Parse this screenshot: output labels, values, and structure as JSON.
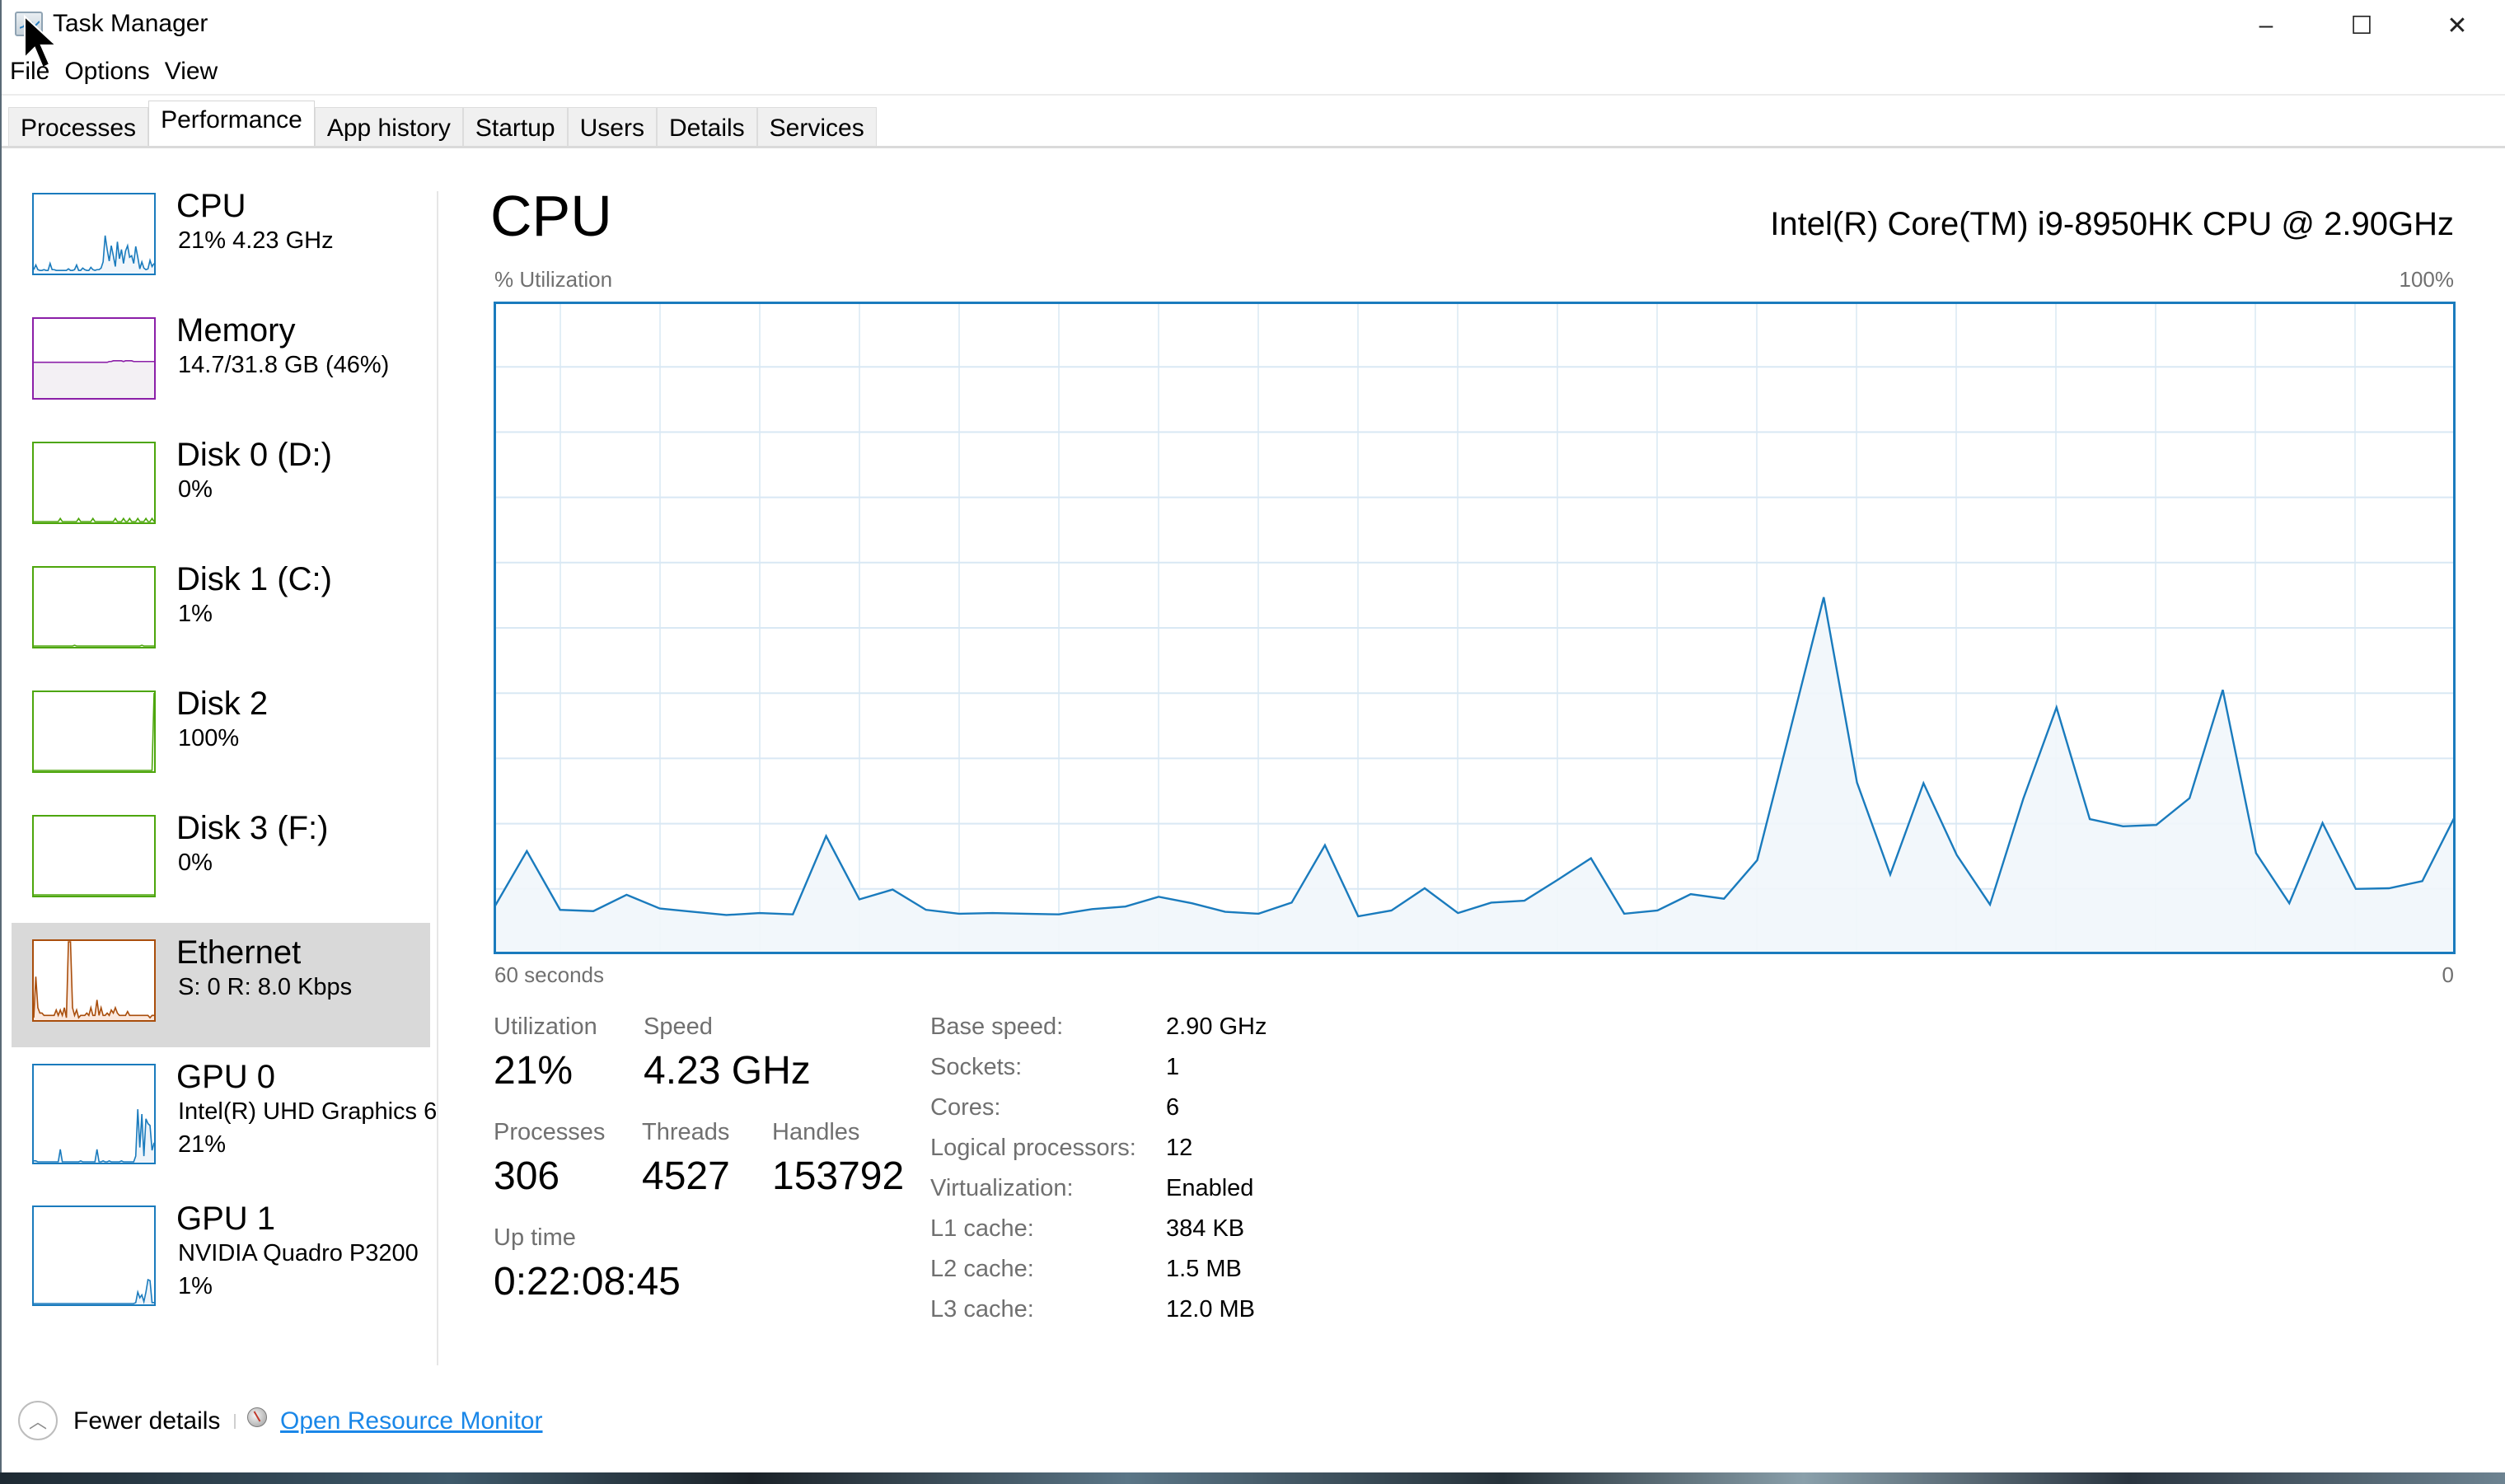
{
  "window": {
    "title": "Task Manager",
    "controls": {
      "minimize": "–",
      "maximize": "☐",
      "close": "✕"
    }
  },
  "menu": [
    "File",
    "Options",
    "View"
  ],
  "tabs": [
    {
      "label": "Processes",
      "active": false
    },
    {
      "label": "Performance",
      "active": true
    },
    {
      "label": "App history",
      "active": false
    },
    {
      "label": "Startup",
      "active": false
    },
    {
      "label": "Users",
      "active": false
    },
    {
      "label": "Details",
      "active": false
    },
    {
      "label": "Services",
      "active": false
    }
  ],
  "sidebar": {
    "items": [
      {
        "title": "CPU",
        "line1": "21%  4.23 GHz",
        "line2": "",
        "color": "#1a7bbd",
        "fill": "#f1f6fb",
        "selected": false,
        "trend": [
          4,
          10,
          4,
          3,
          3,
          4,
          3,
          3,
          12,
          4,
          4,
          3,
          3,
          3,
          3,
          3,
          3,
          5,
          3,
          3,
          4,
          10,
          3,
          3,
          6,
          4,
          3,
          3,
          7,
          4,
          3,
          4,
          4,
          6,
          14,
          48,
          30,
          15,
          35,
          22,
          8,
          40,
          18,
          30,
          12,
          28,
          35,
          20,
          22,
          12,
          34,
          20,
          5,
          14,
          6,
          4,
          5,
          16,
          8,
          12
        ]
      },
      {
        "title": "Memory",
        "line1": "14.7/31.8 GB (46%)",
        "line2": "",
        "color": "#8b1fa8",
        "fill": "#f3f0f4",
        "selected": false,
        "trend": [
          45,
          45,
          45,
          45,
          45,
          45,
          45,
          45,
          45,
          45,
          45,
          45,
          45,
          45,
          45,
          45,
          45,
          45,
          45,
          45,
          45,
          45,
          45,
          45,
          45,
          45,
          45,
          45,
          45,
          45,
          45,
          45,
          45,
          45,
          45,
          45,
          45,
          46,
          46,
          47,
          47,
          47,
          47,
          47,
          46,
          47,
          47,
          47,
          47,
          46,
          46,
          46,
          46,
          46,
          46,
          46,
          46,
          46,
          46,
          46
        ]
      },
      {
        "title": "Disk 0 (D:)",
        "line1": "0%",
        "line2": "",
        "color": "#4da60c",
        "fill": "#ffffff",
        "selected": false,
        "trend": [
          0,
          0,
          0,
          0,
          0,
          0,
          0,
          0,
          0,
          0,
          0,
          0,
          0,
          4,
          0,
          0,
          0,
          0,
          0,
          0,
          0,
          0,
          4,
          0,
          0,
          0,
          0,
          0,
          0,
          4,
          0,
          0,
          0,
          0,
          0,
          0,
          0,
          0,
          0,
          0,
          4,
          0,
          0,
          0,
          4,
          0,
          0,
          4,
          0,
          0,
          0,
          4,
          0,
          0,
          0,
          4,
          0,
          0,
          4,
          0
        ]
      },
      {
        "title": "Disk 1 (C:)",
        "line1": "1%",
        "line2": "",
        "color": "#4da60c",
        "fill": "#ffffff",
        "selected": false,
        "trend": [
          0,
          0,
          0,
          0,
          0,
          0,
          0,
          0,
          0,
          0,
          0,
          0,
          0,
          0,
          0,
          0,
          0,
          0,
          0,
          0,
          1,
          0,
          0,
          0,
          0,
          0,
          0,
          0,
          0,
          0,
          0,
          0,
          0,
          0,
          0,
          0,
          0,
          0,
          0,
          0,
          0,
          0,
          0,
          0,
          0,
          0,
          0,
          0,
          0,
          0,
          0,
          0,
          0,
          1,
          0,
          0,
          0,
          0,
          0,
          0
        ]
      },
      {
        "title": "Disk 2",
        "line1": "100%",
        "line2": "",
        "color": "#4da60c",
        "fill": "#ffffff",
        "selected": false,
        "trend": [
          0,
          0,
          0,
          0,
          0,
          0,
          0,
          0,
          0,
          0,
          0,
          0,
          0,
          0,
          0,
          0,
          0,
          0,
          0,
          0,
          0,
          0,
          0,
          0,
          0,
          0,
          0,
          0,
          0,
          0,
          0,
          0,
          0,
          0,
          0,
          0,
          0,
          0,
          0,
          0,
          0,
          0,
          0,
          0,
          0,
          0,
          0,
          0,
          0,
          0,
          0,
          0,
          0,
          0,
          0,
          0,
          0,
          0,
          0,
          100
        ]
      },
      {
        "title": "Disk 3 (F:)",
        "line1": "0%",
        "line2": "",
        "color": "#4da60c",
        "fill": "#ffffff",
        "selected": false,
        "trend": [
          0,
          0,
          0,
          0,
          0,
          0,
          0,
          0,
          0,
          0,
          0,
          0,
          0,
          0,
          0,
          0,
          0,
          0,
          0,
          0,
          0,
          0,
          0,
          0,
          0,
          0,
          0,
          0,
          0,
          0,
          0,
          0,
          0,
          0,
          0,
          0,
          0,
          0,
          0,
          0,
          0,
          0,
          0,
          0,
          0,
          0,
          0,
          0,
          0,
          0,
          0,
          0,
          0,
          0,
          0,
          0,
          0,
          0,
          0,
          0
        ]
      },
      {
        "title": "Ethernet",
        "line1": "S: 0  R: 8.0 Kbps",
        "line2": "",
        "color": "#a94e0c",
        "fill": "#fbe9df",
        "selected": true,
        "trend": [
          2,
          55,
          15,
          8,
          8,
          5,
          5,
          5,
          5,
          5,
          5,
          12,
          5,
          12,
          5,
          15,
          2,
          100,
          100,
          15,
          5,
          12,
          2,
          5,
          5,
          5,
          8,
          5,
          15,
          5,
          5,
          25,
          5,
          15,
          5,
          5,
          8,
          5,
          12,
          8,
          15,
          8,
          5,
          5,
          5,
          5,
          10,
          5,
          5,
          5,
          5,
          5,
          5,
          5,
          5,
          5,
          5,
          2,
          5,
          5
        ]
      },
      {
        "title": "GPU 0",
        "line1": "Intel(R) UHD Graphics 6",
        "line2": "21%",
        "color": "#1a7bbd",
        "fill": "#eef4fa",
        "selected": false,
        "trend": [
          1,
          1,
          0,
          0,
          0,
          0,
          0,
          0,
          0,
          0,
          0,
          0,
          0,
          13,
          0,
          0,
          0,
          0,
          0,
          0,
          0,
          0,
          0,
          1,
          0,
          0,
          0,
          0,
          0,
          0,
          0,
          13,
          0,
          0,
          1,
          0,
          0,
          1,
          0,
          0,
          0,
          0,
          0,
          1,
          0,
          0,
          0,
          0,
          0,
          0,
          6,
          55,
          15,
          50,
          6,
          45,
          40,
          38,
          12,
          20
        ]
      },
      {
        "title": "GPU 1",
        "line1": "NVIDIA Quadro P3200",
        "line2": "1%",
        "color": "#1a7bbd",
        "fill": "#eef4fa",
        "selected": false,
        "trend": [
          0,
          0,
          0,
          0,
          0,
          0,
          0,
          0,
          0,
          0,
          0,
          0,
          0,
          0,
          0,
          0,
          0,
          0,
          0,
          0,
          0,
          0,
          0,
          0,
          0,
          0,
          0,
          0,
          0,
          0,
          0,
          0,
          0,
          0,
          0,
          0,
          0,
          0,
          0,
          0,
          0,
          0,
          0,
          0,
          0,
          0,
          0,
          0,
          0,
          0,
          1,
          12,
          6,
          9,
          2,
          12,
          25,
          24,
          1,
          1
        ]
      }
    ]
  },
  "main": {
    "title": "CPU",
    "model": "Intel(R) Core(TM) i9-8950HK CPU @ 2.90GHz",
    "stats": {
      "utilization_label": "Utilization",
      "utilization": "21%",
      "speed_label": "Speed",
      "speed": "4.23 GHz",
      "processes_label": "Processes",
      "processes": "306",
      "threads_label": "Threads",
      "threads": "4527",
      "handles_label": "Handles",
      "handles": "153792",
      "uptime_label": "Up time",
      "uptime": "0:22:08:45"
    },
    "info": [
      {
        "label": "Base speed:",
        "value": "2.90 GHz"
      },
      {
        "label": "Sockets:",
        "value": "1"
      },
      {
        "label": "Cores:",
        "value": "6"
      },
      {
        "label": "Logical processors:",
        "value": "12"
      },
      {
        "label": "Virtualization:",
        "value": "Enabled"
      },
      {
        "label": "L1 cache:",
        "value": "384 KB"
      },
      {
        "label": "L2 cache:",
        "value": "1.5 MB"
      },
      {
        "label": "L3 cache:",
        "value": "12.0 MB"
      }
    ]
  },
  "chart_data": {
    "type": "area",
    "title": "% Utilization",
    "ylabel": "% Utilization",
    "y_max_label": "100%",
    "x_left_label": "60 seconds",
    "x_right_label": "0",
    "ylim": [
      0,
      100
    ],
    "xlim": [
      60,
      0
    ],
    "grid": true,
    "line_color": "#1a7bbd",
    "fill_color": "#f1f6fb",
    "grid_color": "#d9e8f4",
    "series": [
      {
        "name": "CPU utilization",
        "values": [
          7,
          15.8,
          6.8,
          6.6,
          9.1,
          7,
          6.5,
          6,
          6.3,
          6.1,
          18.1,
          8.4,
          9.9,
          6.8,
          6.2,
          6.3,
          6.2,
          6.1,
          6.9,
          7.3,
          8.8,
          7.8,
          6.5,
          6.2,
          7.9,
          16.7,
          5.8,
          6.7,
          10.1,
          6.3,
          7.9,
          8.2,
          11.4,
          14.7,
          6.2,
          6.7,
          9.2,
          8.5,
          14.4,
          34.5,
          54.7,
          26.3,
          12.2,
          26.2,
          15.2,
          7.6,
          23.8,
          37.8,
          20.7,
          19.6,
          19.8,
          23.9,
          40.5,
          15.5,
          7.8,
          20.1,
          10,
          10.1,
          11.2,
          21.3
        ]
      }
    ]
  },
  "footer": {
    "fewer_details": "Fewer details",
    "resource_monitor": "Open Resource Monitor"
  }
}
